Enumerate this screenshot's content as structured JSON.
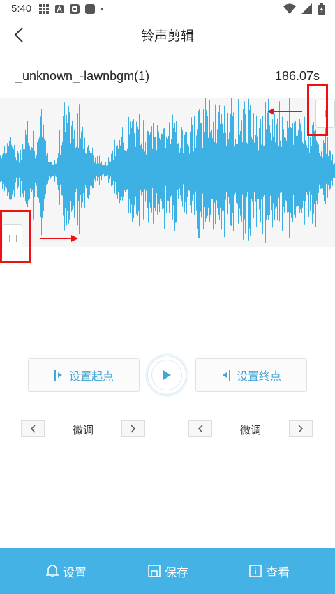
{
  "status_bar": {
    "time": "5:40",
    "left_icons": [
      "grid-icon",
      "a-icon",
      "app-icon",
      "square-icon",
      "dot-icon"
    ],
    "right_icons": [
      "wifi-icon",
      "signal-icon",
      "battery-icon"
    ]
  },
  "header": {
    "title": "铃声剪辑",
    "back_icon": "chevron-left-icon"
  },
  "file": {
    "name": "_unknown_-lawnbgm(1)",
    "duration": "186.07s"
  },
  "waveform": {
    "color": "#3db1e3",
    "background": "#f6f6f6"
  },
  "controls": {
    "set_start_label": "设置起点",
    "set_end_label": "设置终点",
    "play_icon": "play-icon"
  },
  "fine_tune": {
    "left_label": "微调",
    "right_label": "微调"
  },
  "bottom_bar": {
    "settings_label": "设置",
    "save_label": "保存",
    "view_label": "查看",
    "background": "#45b2e6"
  },
  "annotations": {
    "color": "#e11111"
  }
}
